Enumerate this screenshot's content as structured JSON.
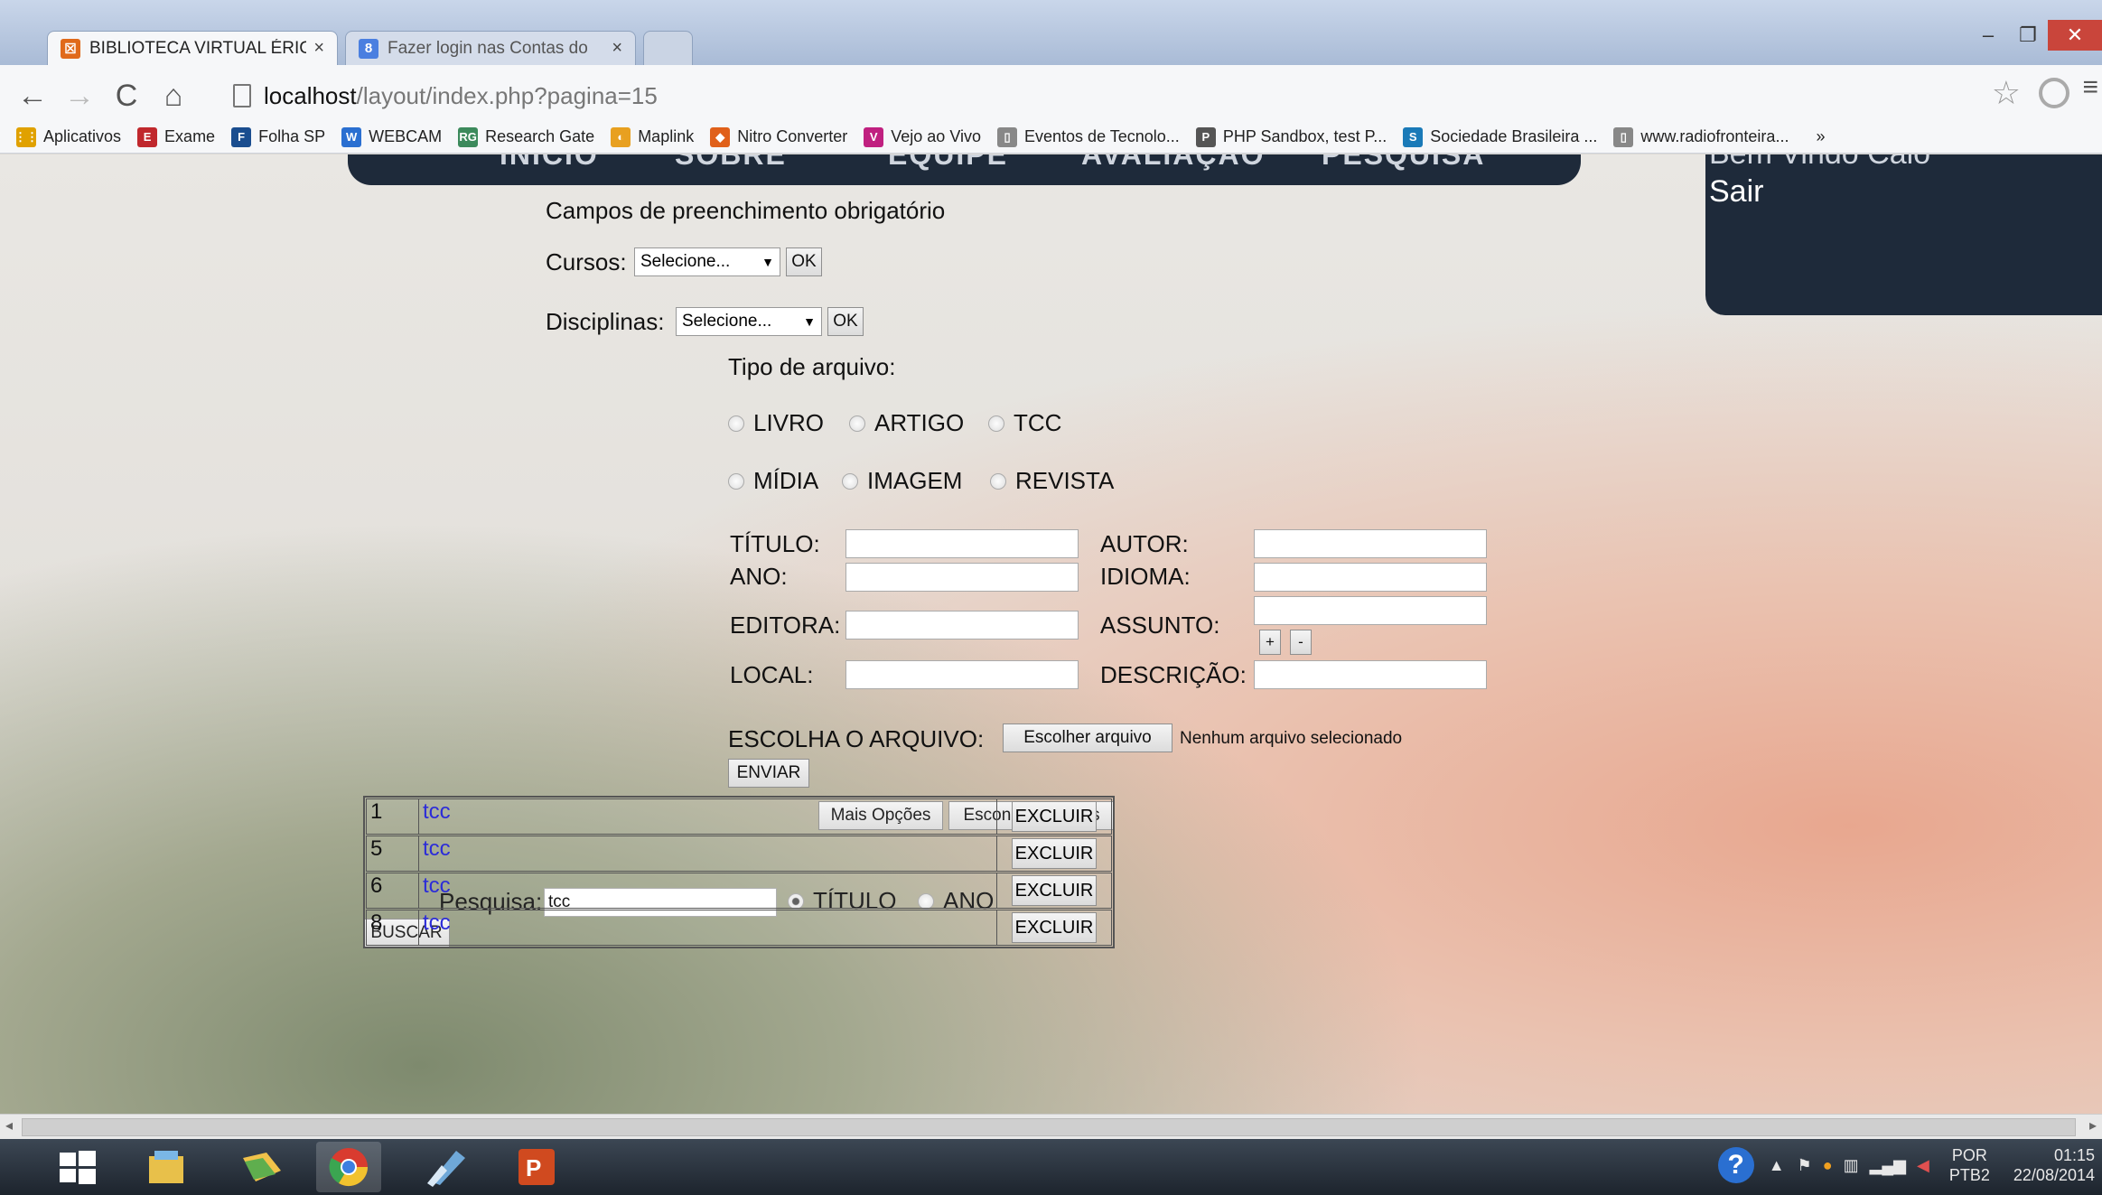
{
  "browser": {
    "tabs": [
      {
        "title": "BIBLIOTECA VIRTUAL ÉRIC",
        "favicon": "xampp-icon",
        "active": true
      },
      {
        "title": "Fazer login nas Contas do",
        "favicon": "google-icon",
        "active": false
      }
    ],
    "close_glyph": "×",
    "url_host": "localhost",
    "url_path": "/layout/index.php?pagina=15",
    "bookmarks": [
      {
        "label": "Aplicativos",
        "color": "#e0a100",
        "glyph": "⋮⋮"
      },
      {
        "label": "Exame",
        "color": "#c0282d",
        "glyph": "E"
      },
      {
        "label": "Folha SP",
        "color": "#1a4d8f",
        "glyph": "F"
      },
      {
        "label": "WEBCAM",
        "color": "#2a6fd1",
        "glyph": "W"
      },
      {
        "label": "Research Gate",
        "color": "#3c8a5c",
        "glyph": "RG"
      },
      {
        "label": "Maplink",
        "color": "#e8a020",
        "glyph": "◐"
      },
      {
        "label": "Nitro Converter",
        "color": "#e0601a",
        "glyph": "◆"
      },
      {
        "label": "Vejo ao Vivo",
        "color": "#c02080",
        "glyph": "V"
      },
      {
        "label": "Eventos de Tecnolo...",
        "color": "#888888",
        "glyph": "▯"
      },
      {
        "label": "PHP Sandbox, test P...",
        "color": "#555555",
        "glyph": "P"
      },
      {
        "label": "Sociedade Brasileira ...",
        "color": "#1a7ab8",
        "glyph": "S"
      },
      {
        "label": "www.radiofronteira...",
        "color": "#888888",
        "glyph": "▯"
      }
    ],
    "more_glyph": "»"
  },
  "site_nav": {
    "items": [
      "INÍCIO",
      "SOBRE",
      "EQUIPE",
      "AVALIAÇÃO",
      "PESQUISA"
    ]
  },
  "user": {
    "welcome": "Bem Vindo Caio",
    "logout": "Sair"
  },
  "form": {
    "required_note": "Campos de preenchimento obrigatório",
    "cursos_label": "Cursos:",
    "cursos_value": "Selecione...",
    "disciplinas_label": "Disciplinas:",
    "disciplinas_value": "Selecione...",
    "ok_label": "OK",
    "tipo_label": "Tipo de arquivo:",
    "tipos_row1": [
      "LIVRO",
      "ARTIGO",
      "TCC"
    ],
    "tipos_row2": [
      "MÍDIA",
      "IMAGEM",
      "REVISTA"
    ],
    "titulo_label": "TÍTULO:",
    "autor_label": "AUTOR:",
    "ano_label": "ANO:",
    "idioma_label": "IDIOMA:",
    "editora_label": "EDITORA:",
    "assunto_label": "ASSUNTO:",
    "local_label": "LOCAL:",
    "descricao_label": "DESCRIÇÃO:",
    "plus_label": "+",
    "minus_label": "-",
    "arquivo_label": "ESCOLHA O ARQUIVO:",
    "choose_file_label": "Escolher arquivo",
    "no_file_text": "Nenhum arquivo selecionado",
    "enviar_label": "ENVIAR",
    "mais_opcoes_label": "Mais Opções",
    "esconder_opcoes_label": "Esconder Opções"
  },
  "search": {
    "label": "Pesquisa:",
    "value": "tcc",
    "option_titulo": "TÍTULO",
    "option_ano": "ANO",
    "buscar_label": "BUSCAR",
    "results": [
      {
        "id": "1",
        "name": "tcc",
        "action": "EXCLUIR"
      },
      {
        "id": "5",
        "name": "tcc",
        "action": "EXCLUIR"
      },
      {
        "id": "6",
        "name": "tcc",
        "action": "EXCLUIR"
      },
      {
        "id": "8",
        "name": "tcc",
        "action": "EXCLUIR"
      }
    ]
  },
  "taskbar": {
    "apps": [
      "start-icon",
      "file-explorer-icon",
      "folder-icon",
      "chrome-icon",
      "notes-icon",
      "powerpoint-icon"
    ],
    "help_glyph": "?",
    "lang": "POR",
    "keyboard": "PTB2",
    "time": "01:15",
    "date": "22/08/2014"
  }
}
